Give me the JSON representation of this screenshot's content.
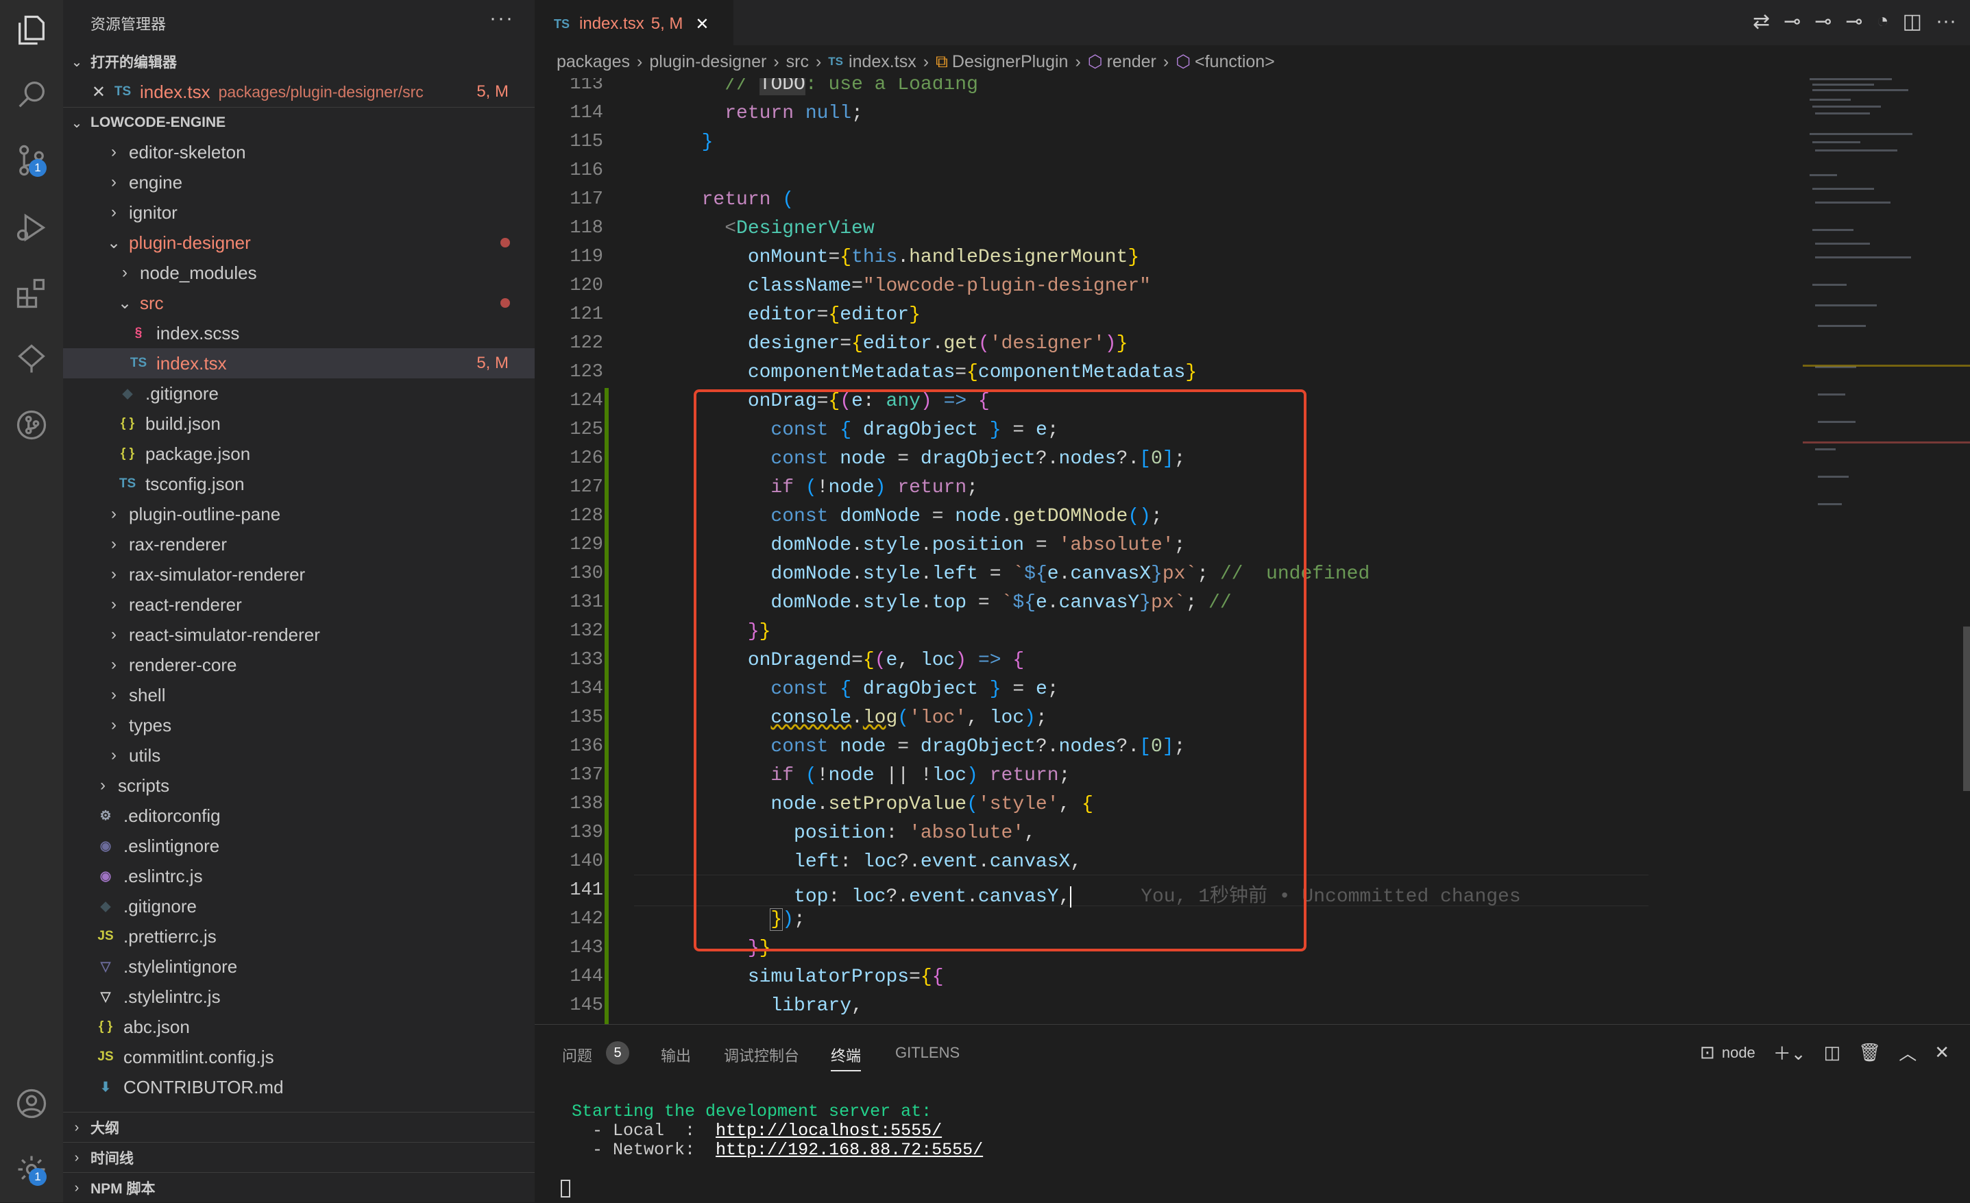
{
  "activity": {
    "scm_badge": "1",
    "settings_badge": "1"
  },
  "sidebar": {
    "title": "资源管理器",
    "more": "···",
    "open_editors": {
      "header": "打开的编辑器",
      "items": [
        {
          "type": "TS",
          "name": "index.tsx",
          "path": "packages/plugin-designer/src",
          "status": "5, M"
        }
      ]
    },
    "workspace": {
      "header": "LOWCODE-ENGINE",
      "items": [
        {
          "name": "editor-skeleton",
          "kind": "folder"
        },
        {
          "name": "engine",
          "kind": "folder"
        },
        {
          "name": "ignitor",
          "kind": "folder"
        },
        {
          "name": "plugin-designer",
          "kind": "folder-open"
        },
        {
          "name": "node_modules",
          "kind": "folder"
        },
        {
          "name": "src",
          "kind": "folder-open"
        },
        {
          "name": "index.scss",
          "kind": "file"
        },
        {
          "name": "index.tsx",
          "kind": "file",
          "status": "5, M"
        },
        {
          "name": ".gitignore",
          "kind": "file"
        },
        {
          "name": "build.json",
          "kind": "file",
          "icon": "{}"
        },
        {
          "name": "package.json",
          "kind": "file",
          "icon": "{}"
        },
        {
          "name": "tsconfig.json",
          "kind": "file",
          "icon": "TS"
        },
        {
          "name": "plugin-outline-pane",
          "kind": "folder"
        },
        {
          "name": "rax-renderer",
          "kind": "folder"
        },
        {
          "name": "rax-simulator-renderer",
          "kind": "folder"
        },
        {
          "name": "react-renderer",
          "kind": "folder"
        },
        {
          "name": "react-simulator-renderer",
          "kind": "folder"
        },
        {
          "name": "renderer-core",
          "kind": "folder"
        },
        {
          "name": "shell",
          "kind": "folder"
        },
        {
          "name": "types",
          "kind": "folder"
        },
        {
          "name": "utils",
          "kind": "folder"
        },
        {
          "name": "scripts",
          "kind": "folder"
        },
        {
          "name": ".editorconfig",
          "kind": "file"
        },
        {
          "name": ".eslintignore",
          "kind": "file"
        },
        {
          "name": ".eslintrc.js",
          "kind": "file"
        },
        {
          "name": ".gitignore",
          "kind": "file"
        },
        {
          "name": ".prettierrc.js",
          "kind": "file",
          "icon": "JS"
        },
        {
          "name": ".stylelintignore",
          "kind": "file"
        },
        {
          "name": ".stylelintrc.js",
          "kind": "file"
        },
        {
          "name": "abc.json",
          "kind": "file",
          "icon": "{}"
        },
        {
          "name": "commitlint.config.js",
          "kind": "file",
          "icon": "JS"
        },
        {
          "name": "CONTRIBUTOR.md",
          "kind": "file"
        }
      ]
    },
    "outline": "大纲",
    "timeline": "时间线",
    "npm": "NPM 脚本"
  },
  "tab": {
    "type": "TS",
    "name": "index.tsx",
    "status": "5, M",
    "close": "✕"
  },
  "breadcrumb": [
    "packages",
    "plugin-designer",
    "src",
    "index.tsx",
    "DesignerPlugin",
    "render",
    "<function>"
  ],
  "editor": {
    "line_numbers": [
      "113",
      "114",
      "115",
      "116",
      "117",
      "118",
      "119",
      "120",
      "121",
      "122",
      "123",
      "124",
      "125",
      "126",
      "127",
      "128",
      "129",
      "130",
      "131",
      "132",
      "133",
      "134",
      "135",
      "136",
      "137",
      "138",
      "139",
      "140",
      "141",
      "142",
      "143",
      "144",
      "145"
    ],
    "current_line": "141",
    "blame": "You, 1秒钟前 • Uncommitted changes"
  },
  "panel": {
    "tabs": [
      "问题",
      "输出",
      "调试控制台",
      "终端",
      "GITLENS"
    ],
    "problems_count": "5",
    "active_tab": "终端",
    "terminal_name": "node",
    "terminal_lines": {
      "l1": "Starting the development server at:",
      "l2_label": "  - Local  :  ",
      "l2_url": "http://localhost:5555/",
      "l3_label": "  - Network:  ",
      "l3_url": "http://192.168.88.72:5555/"
    }
  }
}
